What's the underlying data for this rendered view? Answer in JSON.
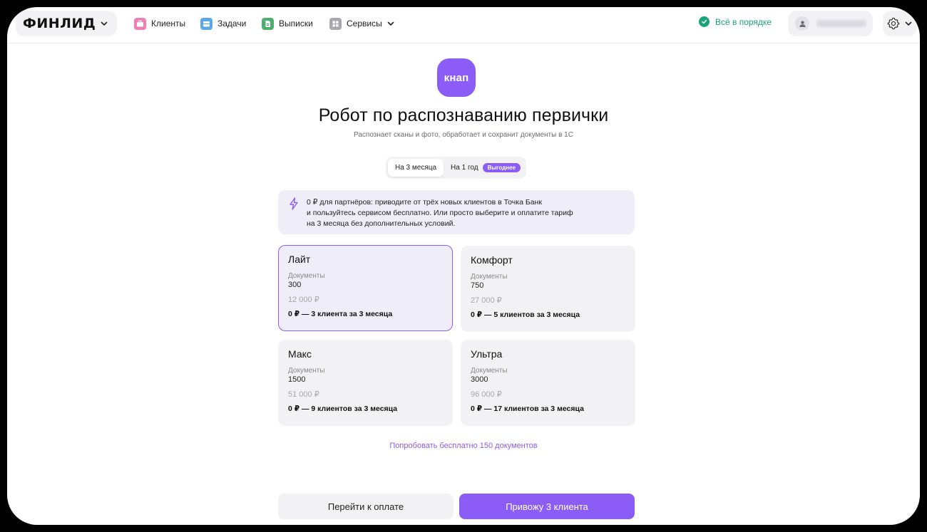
{
  "colors": {
    "accent": "#8b5cf6",
    "accent_soft": "#efedf8",
    "status_ok": "#1aa37a",
    "nav_clients": "#f07fb6",
    "nav_tasks": "#5aa9e6",
    "nav_statements": "#4caf70",
    "nav_services": "#a8a8ad"
  },
  "header": {
    "logo": "ФИНЛИД",
    "nav": [
      {
        "label": "Клиенты",
        "icon": "briefcase-icon"
      },
      {
        "label": "Задачи",
        "icon": "inbox-icon"
      },
      {
        "label": "Выписки",
        "icon": "document-icon"
      },
      {
        "label": "Сервисы",
        "icon": "grid-icon"
      }
    ],
    "status": "Всё в порядке"
  },
  "main": {
    "app_logo": "кнап",
    "title": "Робот по распознаванию первички",
    "subtitle": "Распознает сканы и фото, обработает и сохранит документы в 1С",
    "periods": [
      {
        "label": "На 3 месяца"
      },
      {
        "label": "На 1 год",
        "badge": "Выгоднее"
      }
    ],
    "promo_lines": [
      "0 ₽ для партнёров: приводите от трёх новых клиентов в Точка Банк",
      "и пользуйтесь сервисом бесплатно. Или просто выберите и оплатите тариф",
      "на 3 месяца без дополнительных условий."
    ],
    "plans": [
      {
        "name": "Лайт",
        "label": "Документы",
        "count": "300",
        "price": "12 000 ₽",
        "offer": "0 ₽ — 3 клиента за 3 месяца"
      },
      {
        "name": "Комфорт",
        "label": "Документы",
        "count": "750",
        "price": "27 000 ₽",
        "offer": "0 ₽ — 5 клиентов за 3 месяца"
      },
      {
        "name": "Макс",
        "label": "Документы",
        "count": "1500",
        "price": "51 000 ₽",
        "offer": "0 ₽ — 9 клиентов за 3 месяца"
      },
      {
        "name": "Ультра",
        "label": "Документы",
        "count": "3000",
        "price": "96 000 ₽",
        "offer": "0 ₽ — 17 клиентов за 3 месяца"
      }
    ],
    "try_link": "Попробовать бесплатно 150 документов",
    "pay_button": "Перейти к оплате",
    "bring_button": "Привожу 3 клиента"
  }
}
